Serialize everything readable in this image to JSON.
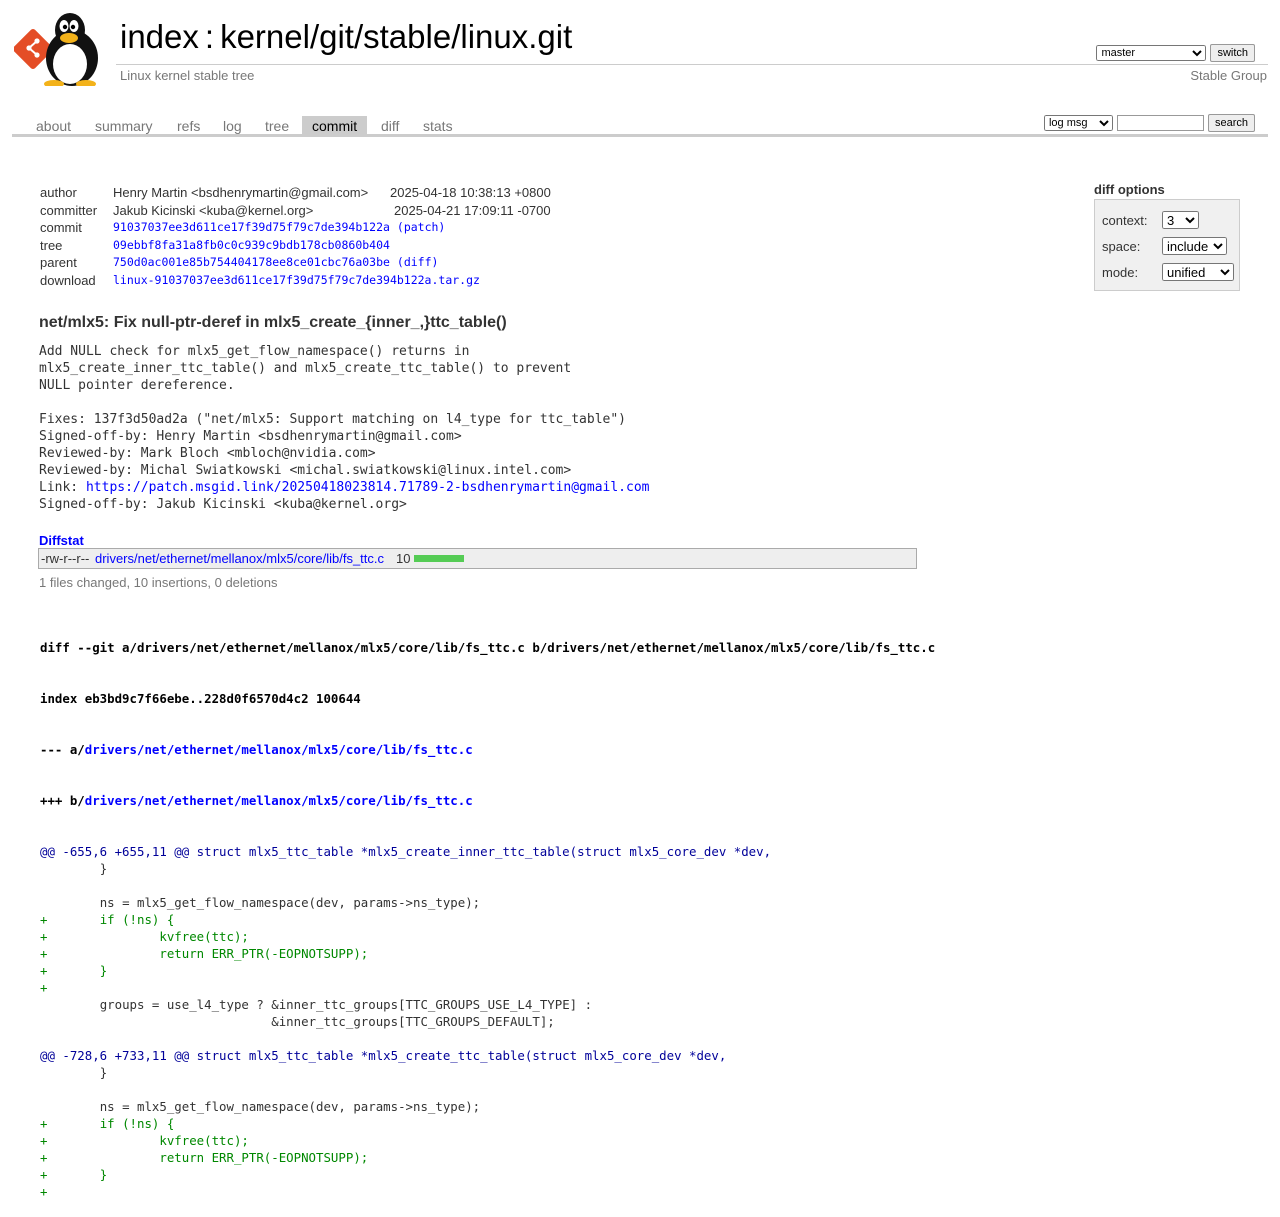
{
  "header": {
    "title_index": "index",
    "title_sep": ":",
    "title_repo": "kernel/git/stable/linux.git",
    "subtitle": "Linux kernel stable tree",
    "branch_selected": "master",
    "switch_label": "switch",
    "owner": "Stable Group"
  },
  "tabs": [
    "about",
    "summary",
    "refs",
    "log",
    "tree",
    "commit",
    "diff",
    "stats"
  ],
  "active_tab": "commit",
  "search": {
    "scope_selected": "log msg",
    "query": "",
    "button_label": "search"
  },
  "commit_info": {
    "author_label": "author",
    "author": "Henry Martin <bsdhenrymartin@gmail.com>",
    "author_date": "2025-04-18 10:38:13 +0800",
    "committer_label": "committer",
    "committer": "Jakub Kicinski <kuba@kernel.org>",
    "committer_date": "2025-04-21 17:09:11 -0700",
    "commit_label": "commit",
    "commit_hash": "91037037ee3d611ce17f39d75f79c7de394b122a",
    "commit_link": "(patch)",
    "tree_label": "tree",
    "tree_hash": "09ebbf8fa31a8fb0c0c939c9bdb178cb0860b404",
    "parent_label": "parent",
    "parent_hash": "750d0ac001e85b754404178ee8ce01cbc76a03be",
    "parent_link": "(diff)",
    "download_label": "download",
    "download_file": "linux-91037037ee3d611ce17f39d75f79c7de394b122a.tar.gz"
  },
  "diff_options": {
    "title": "diff options",
    "context_label": "context:",
    "context_value": "3",
    "space_label": "space:",
    "space_value": "include",
    "mode_label": "mode:",
    "mode_value": "unified"
  },
  "subject": "net/mlx5: Fix null-ptr-deref in mlx5_create_{inner_,}ttc_table()",
  "message_lines": [
    "Add NULL check for mlx5_get_flow_namespace() returns in",
    "mlx5_create_inner_ttc_table() and mlx5_create_ttc_table() to prevent",
    "NULL pointer dereference.",
    "",
    "Fixes: 137f3d50ad2a (\"net/mlx5: Support matching on l4_type for ttc_table\")",
    "Signed-off-by: Henry Martin <bsdhenrymartin@gmail.com>",
    "Reviewed-by: Mark Bloch <mbloch@nvidia.com>",
    "Reviewed-by: Michal Swiatkowski <michal.swiatkowski@linux.intel.com>"
  ],
  "message_link_prefix": "Link: ",
  "message_link": "https://patch.msgid.link/20250418023814.71789-2-bsdhenrymartin@gmail.com",
  "message_last": "Signed-off-by: Jakub Kicinski <kuba@kernel.org>",
  "diffstat": {
    "title": "Diffstat",
    "mode": "-rw-r--r--",
    "path": "drivers/net/ethernet/mellanox/mlx5/core/lib/fs_ttc.c",
    "count": "10",
    "bar_fraction": 1.0,
    "summary": "1 files changed, 10 insertions, 0 deletions"
  },
  "diff": {
    "git_line": "diff --git a/drivers/net/ethernet/mellanox/mlx5/core/lib/fs_ttc.c b/drivers/net/ethernet/mellanox/mlx5/core/lib/fs_ttc.c",
    "index_line": "index eb3bd9c7f66ebe..228d0f6570d4c2 100644",
    "old_prefix": "--- a/",
    "new_prefix": "+++ b/",
    "file_path": "drivers/net/ethernet/mellanox/mlx5/core/lib/fs_ttc.c",
    "lines": [
      {
        "t": "hunk",
        "s": "@@ -655,6 +655,11 @@ struct mlx5_ttc_table *mlx5_create_inner_ttc_table(struct mlx5_core_dev *dev,"
      },
      {
        "t": "ctx",
        "s": " \t}"
      },
      {
        "t": "ctx",
        "s": " "
      },
      {
        "t": "ctx",
        "s": " \tns = mlx5_get_flow_namespace(dev, params->ns_type);"
      },
      {
        "t": "add",
        "s": "+\tif (!ns) {"
      },
      {
        "t": "add",
        "s": "+\t\tkvfree(ttc);"
      },
      {
        "t": "add",
        "s": "+\t\treturn ERR_PTR(-EOPNOTSUPP);"
      },
      {
        "t": "add",
        "s": "+\t}"
      },
      {
        "t": "add",
        "s": "+"
      },
      {
        "t": "ctx",
        "s": " \tgroups = use_l4_type ? &inner_ttc_groups[TTC_GROUPS_USE_L4_TYPE] :"
      },
      {
        "t": "ctx",
        "s": " \t\t\t       &inner_ttc_groups[TTC_GROUPS_DEFAULT];"
      },
      {
        "t": "ctx",
        "s": " "
      },
      {
        "t": "hunk",
        "s": "@@ -728,6 +733,11 @@ struct mlx5_ttc_table *mlx5_create_ttc_table(struct mlx5_core_dev *dev,"
      },
      {
        "t": "ctx",
        "s": " \t}"
      },
      {
        "t": "ctx",
        "s": " "
      },
      {
        "t": "ctx",
        "s": " \tns = mlx5_get_flow_namespace(dev, params->ns_type);"
      },
      {
        "t": "add",
        "s": "+\tif (!ns) {"
      },
      {
        "t": "add",
        "s": "+\t\tkvfree(ttc);"
      },
      {
        "t": "add",
        "s": "+\t\treturn ERR_PTR(-EOPNOTSUPP);"
      },
      {
        "t": "add",
        "s": "+\t}"
      },
      {
        "t": "add",
        "s": "+"
      }
    ]
  }
}
